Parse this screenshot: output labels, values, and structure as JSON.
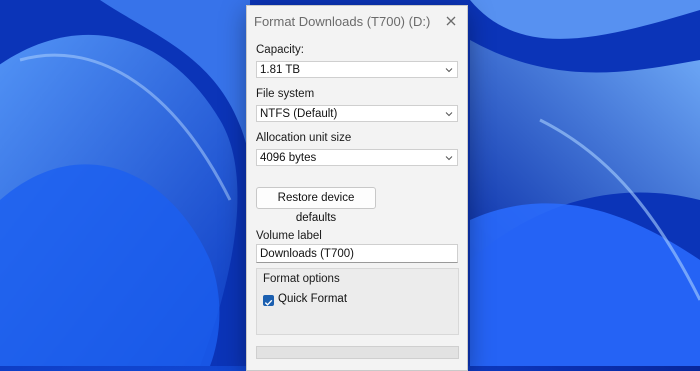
{
  "dialog": {
    "title": "Format Downloads (T700) (D:)"
  },
  "capacity": {
    "label": "Capacity:",
    "value": "1.81 TB"
  },
  "file_system": {
    "label": "File system",
    "value": "NTFS (Default)"
  },
  "allocation": {
    "label": "Allocation unit size",
    "value": "4096 bytes"
  },
  "restore_button": "Restore device defaults",
  "volume_label": {
    "label": "Volume label",
    "value": "Downloads (T700)"
  },
  "format_options": {
    "title": "Format options",
    "quick_format": {
      "label": "Quick Format",
      "checked": true
    }
  },
  "progress": {
    "value": 0
  },
  "icons": {
    "close": "close-icon",
    "dropdown": "chevron-down-icon",
    "check": "checkmark-icon"
  },
  "colors": {
    "accent": "#1b5fb0",
    "wallpaper": "#1450e0"
  }
}
